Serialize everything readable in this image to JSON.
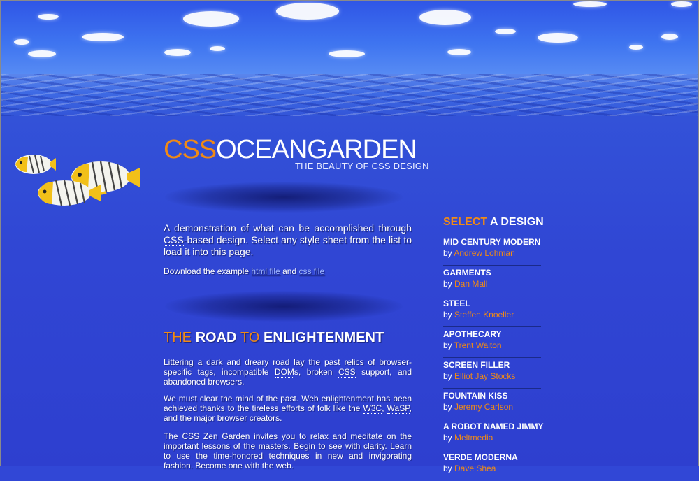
{
  "logo": {
    "part1": "CSS",
    "part2": "OCEAN",
    "part3": "GARDEN",
    "tagline": "THE BEAUTY OF CSS DESIGN"
  },
  "intro": {
    "p1_a": "A demonstration of what can be accomplished through ",
    "p1_abbr": "CSS",
    "p1_b": "-based design. Select any style sheet from the list to load it into this page.",
    "download_prefix": "Download the example ",
    "html_link": "html file",
    "and": " and ",
    "css_link": "css file"
  },
  "road": {
    "title": {
      "the": "THE ",
      "road": "ROAD ",
      "to": "TO ",
      "enlight": "ENLIGHTENMENT"
    },
    "p1_a": "Littering a dark and dreary road lay the past relics of browser-specific tags, incompatible ",
    "p1_dom": "DOM",
    "p1_b": "s, broken ",
    "p1_css": "CSS",
    "p1_c": " support, and abandoned browsers.",
    "p2_a": "We must clear the mind of the past. Web enlightenment has been achieved thanks to the tireless efforts of folk like the ",
    "p2_w3c": "W3C",
    "p2_b": ", ",
    "p2_wasp": "WaSP",
    "p2_c": ", and the major browser creators.",
    "p3": "The CSS Zen Garden invites you to relax and meditate on the important lessons of the masters. Begin to see with clarity. Learn to use the time-honored techniques in new and invigorating fashion. Become one with the web."
  },
  "sidebar": {
    "title_a": "SELECT ",
    "title_b": "A DESIGN",
    "by": "by ",
    "designs": [
      {
        "name": "MID CENTURY MODERN",
        "author": "Andrew Lohman"
      },
      {
        "name": "GARMENTS",
        "author": "Dan Mall"
      },
      {
        "name": "STEEL",
        "author": "Steffen Knoeller"
      },
      {
        "name": "APOTHECARY",
        "author": "Trent Walton"
      },
      {
        "name": "SCREEN FILLER",
        "author": "Elliot Jay Stocks"
      },
      {
        "name": "FOUNTAIN KISS",
        "author": "Jeremy Carlson"
      },
      {
        "name": "A ROBOT NAMED JIMMY",
        "author": "Meltmedia"
      },
      {
        "name": "VERDE MODERNA",
        "author": "Dave Shea"
      }
    ]
  },
  "colors": {
    "accent": "#f08a16",
    "sea": "#3147d6",
    "text": "#ffffff"
  },
  "icons": [
    "cloud-icon",
    "fish-icon"
  ]
}
